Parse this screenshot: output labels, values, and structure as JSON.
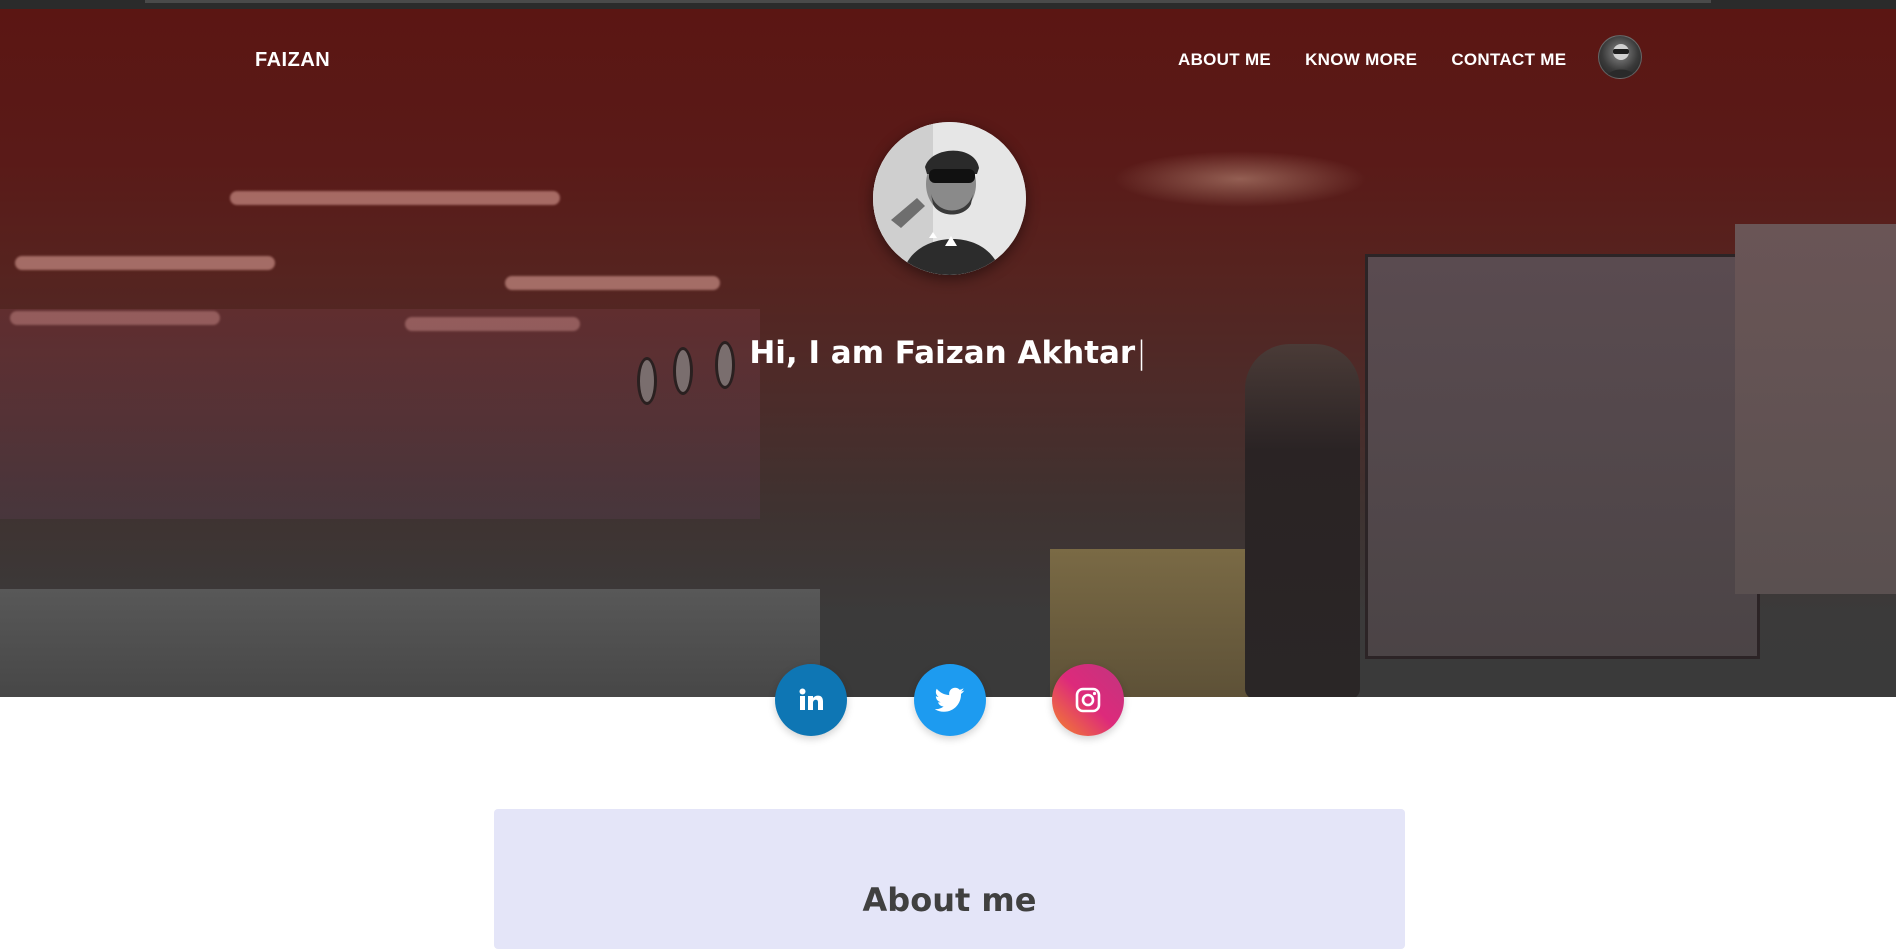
{
  "navbar": {
    "brand": "FAIZAN",
    "links": [
      {
        "label": "ABOUT ME"
      },
      {
        "label": "KNOW MORE"
      },
      {
        "label": "CONTACT ME"
      }
    ],
    "avatar_icon": "user-avatar"
  },
  "hero": {
    "greeting": "Hi, I am Faizan Akhtar",
    "caret": "|",
    "profile_photo_icon": "profile-photo"
  },
  "social": [
    {
      "name": "linkedin",
      "icon": "linkedin-icon",
      "color": "#0e76b4"
    },
    {
      "name": "twitter",
      "icon": "twitter-icon",
      "color": "#1d9bf0"
    },
    {
      "name": "instagram",
      "icon": "instagram-icon",
      "color": "#dd2a7b"
    }
  ],
  "about": {
    "title": "About me"
  },
  "colors": {
    "hero_overlay": "#5b1613",
    "about_card_bg": "#e4e5f8",
    "heading_text": "#404040"
  }
}
